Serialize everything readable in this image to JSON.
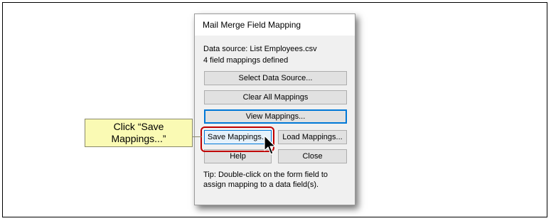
{
  "dialog": {
    "title": "Mail Merge Field Mapping",
    "data_source": "Data source: List Employees.csv",
    "mapping_count": "4 field mappings defined",
    "buttons": {
      "select_source": "Select Data Source...",
      "clear_all": "Clear All Mappings",
      "view": "View Mappings...",
      "save": "Save Mappings...",
      "load": "Load Mappings...",
      "help": "Help",
      "close": "Close"
    },
    "tip": "Tip: Double-click on the form field to assign mapping to a data field(s)."
  },
  "callout": {
    "text": "Click “Save Mappings...”"
  },
  "colors": {
    "callout_bg": "#fafab4",
    "highlight": "#c00000",
    "focus_border": "#0078d7"
  },
  "icons": {
    "cursor": "mouse-pointer-icon"
  }
}
